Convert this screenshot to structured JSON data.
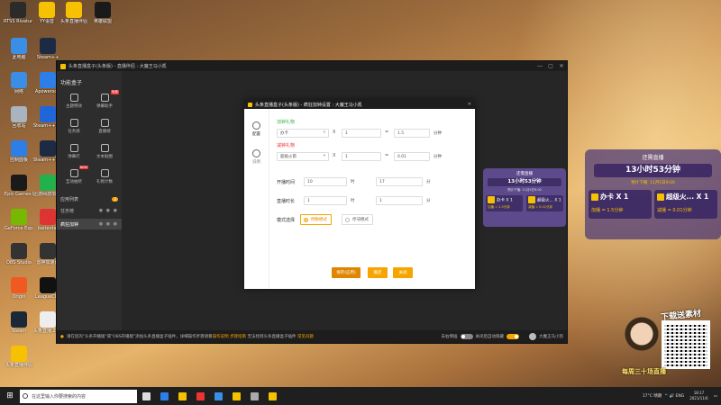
{
  "desktop": {
    "icons": [
      {
        "label": "RTSS Rivatune",
        "color": "#2b2b2b"
      },
      {
        "label": "YY语音",
        "color": "#f6c100"
      },
      {
        "label": "头条直播伴侣",
        "color": "#f6c100"
      },
      {
        "label": "英雄联盟",
        "color": "#1a1a1a"
      },
      {
        "label": "此电脑",
        "color": "#3b8ee6"
      },
      {
        "label": "Steam++",
        "color": "#1d2a44"
      },
      {
        "label": "网络",
        "color": "#3b8ee6"
      },
      {
        "label": "Apowersoft",
        "color": "#2e7ee8"
      },
      {
        "label": "回收站",
        "color": "#aab4c0"
      },
      {
        "label": "Steam++加速",
        "color": "#2166d9"
      },
      {
        "label": "控制面板",
        "color": "#2e7ee8"
      },
      {
        "label": "Steam++官方",
        "color": "#1d2a44"
      },
      {
        "label": "Epic Games Launcher",
        "color": "#1a1a1a"
      },
      {
        "label": "迅游网游加速器",
        "color": "#23b14d"
      },
      {
        "label": "GeForce Experience",
        "color": "#76b900"
      },
      {
        "label": "baitentai",
        "color": "#d33"
      },
      {
        "label": "OBS Studio",
        "color": "#333"
      },
      {
        "label": "雷神加速器",
        "color": "#333"
      },
      {
        "label": "Origin",
        "color": "#f05a22"
      },
      {
        "label": "LeagueCl...",
        "color": "#111"
      },
      {
        "label": "Steam",
        "color": "#1b2838"
      },
      {
        "label": "头条直播 2014.md",
        "color": "#eee"
      },
      {
        "label": "头条直播伴侣",
        "color": "#f6c100"
      }
    ]
  },
  "main_window": {
    "title": "头条直播盒子(头条版) - 直播伴侣 : 大魔王马小凯",
    "controls": [
      "—",
      "▢",
      "✕"
    ],
    "sidebar": {
      "header": "功能盒子",
      "tools": [
        {
          "label": "主题特效",
          "badge": ""
        },
        {
          "label": "弹幕助手",
          "badge": "免费"
        },
        {
          "label": "任务榜",
          "badge": ""
        },
        {
          "label": "直播榜",
          "badge": ""
        },
        {
          "label": "弹幕打",
          "badge": ""
        },
        {
          "label": "文本贴图",
          "badge": ""
        },
        {
          "label": "互动抽奖",
          "badge": "NEW"
        },
        {
          "label": "礼物计数",
          "badge": ""
        }
      ],
      "apps_header": "应用列表",
      "apps_count": "2",
      "apps": [
        {
          "label": "任务榜",
          "active": false
        },
        {
          "label": "疯狂加钟",
          "active": true
        }
      ]
    },
    "bottom": {
      "notice": "请在您的\"头条开播版\"或\"OBS开播版\"添加头条直播盒子插件，详细操作步骤请看",
      "link1": "操作说明",
      "link2": "步骤指南",
      "notice2": "无法找到头条直播盒子插件",
      "link3": "常见问题",
      "toggle1_label": "去右侧插",
      "toggle2_label": "关闭后自动隐藏",
      "user": "大魔王马小凯"
    }
  },
  "dialog": {
    "title": "头条直播盒子(头条版) - 疯狂加钟设置 : 大魔王马小凯",
    "nav": [
      {
        "label": "配置",
        "active": true
      },
      {
        "label": "说明",
        "active": false
      }
    ],
    "add_section": "加钟礼物",
    "add_row": {
      "gift": "办卡",
      "op": "X",
      "count": "1",
      "eq": "=",
      "minutes": "1.5",
      "unit": "分钟"
    },
    "sub_section": "减钟礼物",
    "sub_row": {
      "gift": "超级火箭",
      "op": "X",
      "count": "1",
      "eq": "=",
      "minutes": "0.01",
      "unit": "分钟"
    },
    "start_label": "开播时间",
    "start_hour": "10",
    "start_hour_unit": "时",
    "start_min": "17",
    "start_min_unit": "分",
    "dur_label": "直播时长",
    "dur_hour": "1",
    "dur_hour_unit": "时",
    "dur_min": "1",
    "dur_min_unit": "分",
    "mode_label": "模式选择",
    "mode1": "倒数模式",
    "mode2": "停滞模式",
    "buttons": {
      "save": "保存(应用)",
      "confirm": "确定",
      "cancel": "关闭"
    }
  },
  "widget_small": {
    "header": "还需直播",
    "time": "13小时53分钟",
    "sub": "预计下播: 11月5日9:00",
    "gift1": "办卡 X 1",
    "gift1_rate": "加播 = 1.5分钟",
    "gift2": "超级火... X 1",
    "gift2_rate": "减播 = 0.01分钟"
  },
  "widget_large": {
    "header": "还需直播",
    "time": "13小时53分钟",
    "sub": "预计下播: 11月5日9:00",
    "gift1": "办卡 X 1",
    "gift1_rate": "加播 = 1.5分钟",
    "gift2": "超级火... X 1",
    "gift2_rate": "减播 = 0.01分钟"
  },
  "promo": {
    "title": "下载送素材",
    "bottom": "每周三十场直播"
  },
  "taskbar": {
    "search_placeholder": "在这里输入你要搜索的内容",
    "apps": [
      "#ddd",
      "#2e7ee8",
      "#f6c100",
      "#e33",
      "#3b8ee6",
      "#f6c100",
      "#aaa",
      "#f6c100"
    ],
    "weather": "17°C 晴朗",
    "lang": "ENG",
    "time": "18:17",
    "date": "2021/11/6"
  }
}
